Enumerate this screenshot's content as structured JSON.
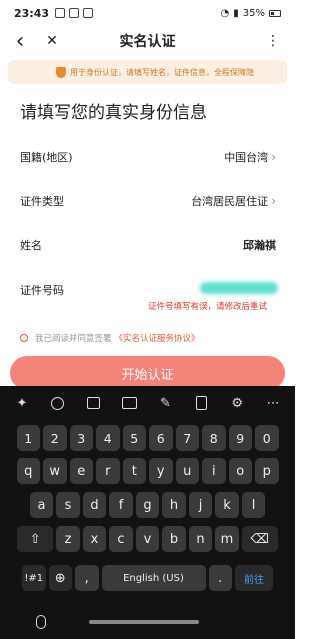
{
  "status_bar": {
    "time": "23:43",
    "battery": "35%"
  },
  "nav": {
    "back_glyph": "‹",
    "close_glyph": "✕",
    "title": "实名认证",
    "more_glyph": "⋮"
  },
  "notice": {
    "text": "用于身份认证，请填写姓名，证件信息，全程保障隐"
  },
  "heading": "请填写您的真实身份信息",
  "form": {
    "nationality": {
      "label": "国籍(地区)",
      "value": "中国台湾"
    },
    "doc_type": {
      "label": "证件类型",
      "value": "台湾居民居住证"
    },
    "name": {
      "label": "姓名",
      "value": "邱瀚祺"
    },
    "id_number": {
      "label": "证件号码",
      "value": ""
    },
    "error": "证件号填写有误，请修改后重试"
  },
  "agreement": {
    "text": "我已阅读并同意签署",
    "link": "《实名认证服务协议》"
  },
  "submit_label": "开始认证",
  "keyboard": {
    "toolbar": [
      "sparkle-icon",
      "emoji-icon",
      "sticker-icon",
      "keyboard-icon",
      "handwriting-icon",
      "clipboard-icon",
      "settings-icon",
      "more-icon"
    ],
    "row1": [
      "1",
      "2",
      "3",
      "4",
      "5",
      "6",
      "7",
      "8",
      "9",
      "0"
    ],
    "row2": [
      "q",
      "w",
      "e",
      "r",
      "t",
      "y",
      "u",
      "i",
      "o",
      "p"
    ],
    "row3": [
      "a",
      "s",
      "d",
      "f",
      "g",
      "h",
      "j",
      "k",
      "l"
    ],
    "row4": [
      "z",
      "x",
      "c",
      "v",
      "b",
      "n",
      "m"
    ],
    "shift_glyph": "⇧",
    "backspace_glyph": "⌫",
    "sym_label": "!#1",
    "globe_glyph": "⊕",
    "comma": ",",
    "space_label": "English (US)",
    "period": ".",
    "go_label": "前往"
  }
}
